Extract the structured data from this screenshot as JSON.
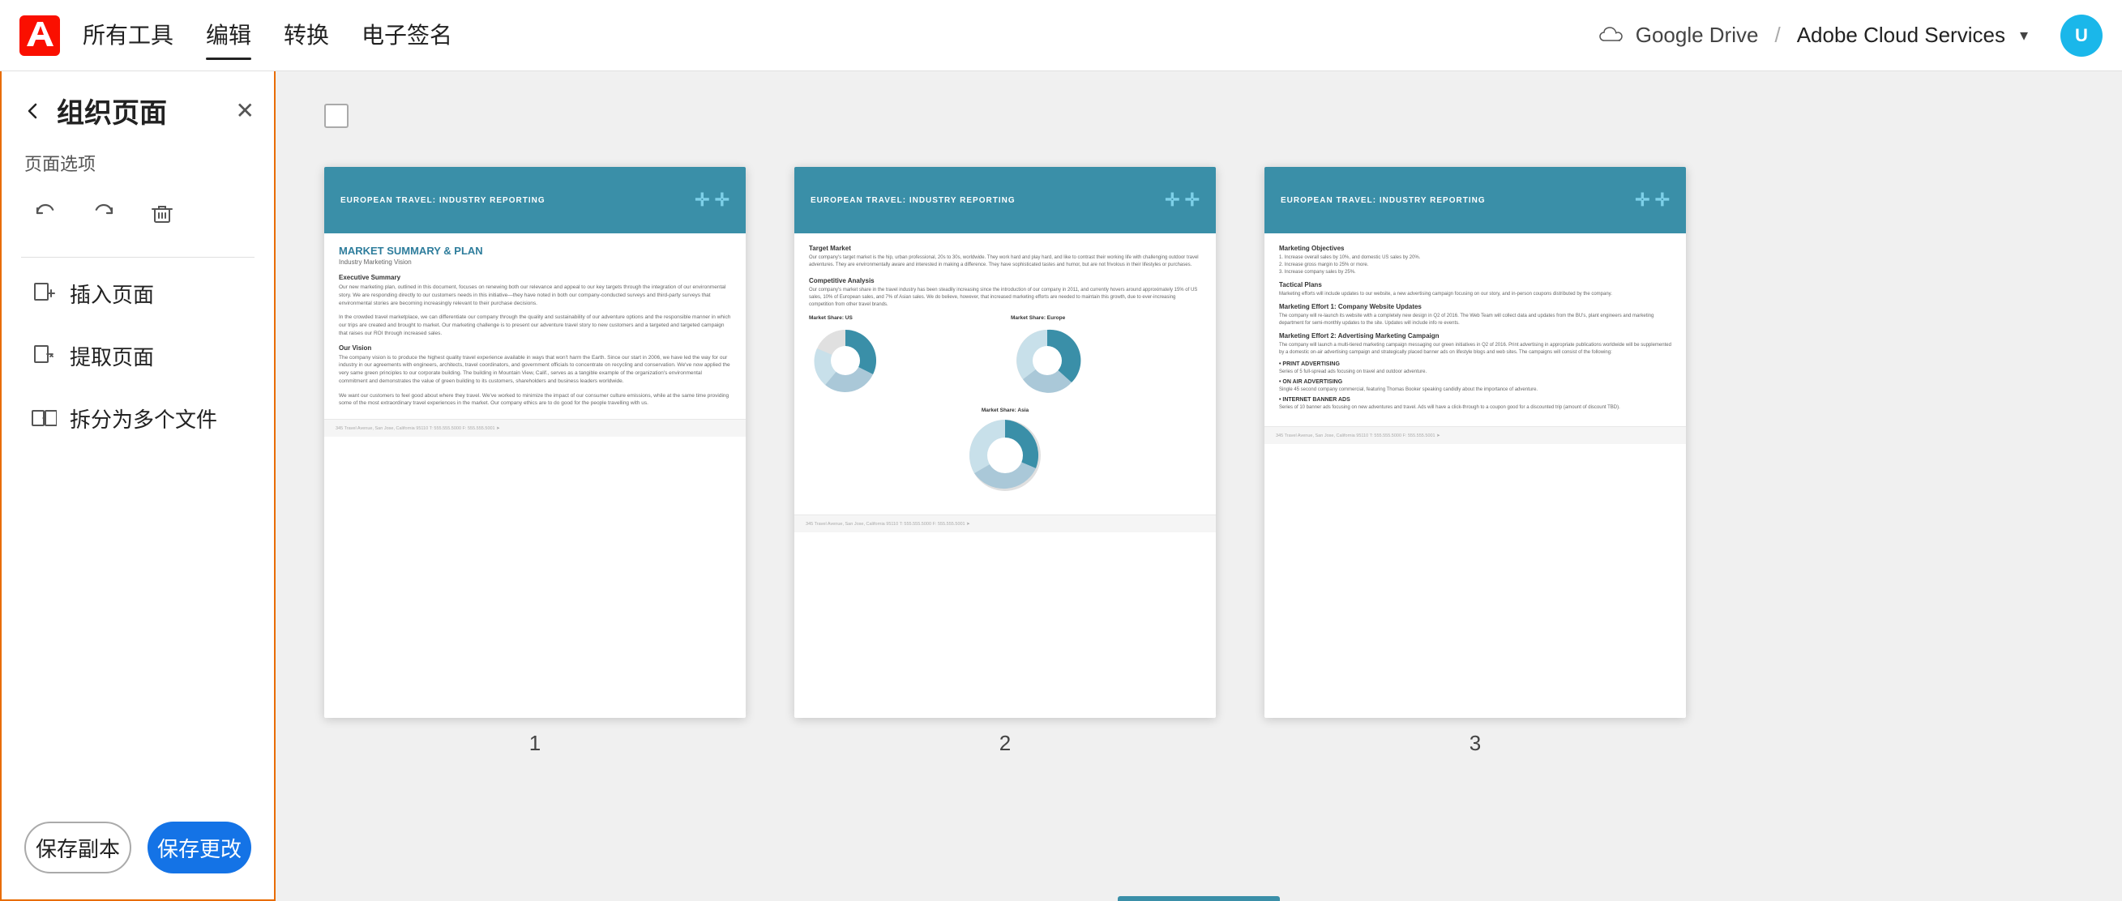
{
  "topbar": {
    "nav_items": [
      {
        "label": "所有工具",
        "active": false
      },
      {
        "label": "编辑",
        "active": true
      },
      {
        "label": "转换",
        "active": false
      },
      {
        "label": "电子签名",
        "active": false
      }
    ],
    "cloud_drive": "Google Drive",
    "cloud_service": "Adobe Cloud Services",
    "chevron": "▾",
    "user_initial": "U"
  },
  "left_panel": {
    "title": "组织页面",
    "section_label": "页面选项",
    "menu_items": [
      {
        "label": "插入页面"
      },
      {
        "label": "提取页面"
      },
      {
        "label": "拆分为多个文件"
      }
    ],
    "btn_save_copy": "保存副本",
    "btn_save_changes": "保存更改"
  },
  "content": {
    "pages": [
      {
        "number": "1",
        "title": "MARKET SUMMARY & PLAN",
        "subtitle": "Industry Marketing Vision",
        "header_label": "EUROPEAN TRAVEL: INDUSTRY REPORTING"
      },
      {
        "number": "2",
        "header_label": "EUROPEAN TRAVEL: INDUSTRY REPORTING"
      },
      {
        "number": "3",
        "header_label": "EUROPEAN TRAVEL: INDUSTRY REPORTING"
      }
    ]
  }
}
